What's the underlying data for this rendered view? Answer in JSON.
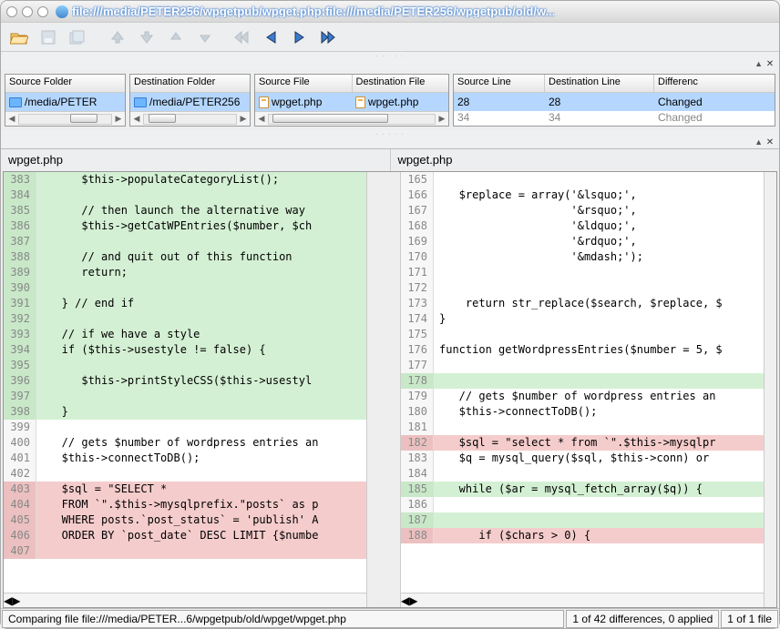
{
  "window": {
    "title": "file:///media/PETER256/wpgetpub/wpget.php:file:///media/PETER256/wpgetpub/old/w..."
  },
  "panels": {
    "source_folder": {
      "header": "Source Folder",
      "value": "/media/PETER"
    },
    "dest_folder": {
      "header": "Destination Folder",
      "value": "/media/PETER256"
    },
    "source_file": {
      "header": "Source File",
      "value": "wpget.php"
    },
    "dest_file": {
      "header": "Destination File",
      "value": "wpget.php"
    },
    "source_line": {
      "header": "Source Line"
    },
    "dest_line": {
      "header": "Destination Line"
    },
    "difference": {
      "header": "Differenc"
    },
    "rows": [
      {
        "src": "28",
        "dst": "28",
        "diff": "Changed"
      },
      {
        "src": "34",
        "dst": "34",
        "diff": "Changed"
      }
    ]
  },
  "diff": {
    "left_title": "wpget.php",
    "right_title": "wpget.php",
    "left": [
      {
        "n": "383",
        "t": "      $this->populateCategoryList();",
        "c": "add"
      },
      {
        "n": "384",
        "t": "",
        "c": "add"
      },
      {
        "n": "385",
        "t": "      // then launch the alternative way",
        "c": "add"
      },
      {
        "n": "386",
        "t": "      $this->getCatWPEntries($number, $ch",
        "c": "add"
      },
      {
        "n": "387",
        "t": "",
        "c": "add"
      },
      {
        "n": "388",
        "t": "      // and quit out of this function",
        "c": "add"
      },
      {
        "n": "389",
        "t": "      return;",
        "c": "add"
      },
      {
        "n": "390",
        "t": "",
        "c": "add"
      },
      {
        "n": "391",
        "t": "   } // end if",
        "c": "add"
      },
      {
        "n": "392",
        "t": "",
        "c": "add"
      },
      {
        "n": "393",
        "t": "   // if we have a style",
        "c": "add"
      },
      {
        "n": "394",
        "t": "   if ($this->usestyle != false) {",
        "c": "add"
      },
      {
        "n": "395",
        "t": "",
        "c": "add"
      },
      {
        "n": "396",
        "t": "      $this->printStyleCSS($this->usestyl",
        "c": "add"
      },
      {
        "n": "397",
        "t": "",
        "c": "add"
      },
      {
        "n": "398",
        "t": "   }",
        "c": "add"
      },
      {
        "n": "399",
        "t": "",
        "c": ""
      },
      {
        "n": "400",
        "t": "   // gets $number of wordpress entries an",
        "c": ""
      },
      {
        "n": "401",
        "t": "   $this->connectToDB();",
        "c": ""
      },
      {
        "n": "402",
        "t": "",
        "c": ""
      },
      {
        "n": "403",
        "t": "   $sql = \"SELECT *",
        "c": "del"
      },
      {
        "n": "404",
        "t": "   FROM `\".$this->mysqlprefix.\"posts` as p",
        "c": "del"
      },
      {
        "n": "405",
        "t": "   WHERE posts.`post_status` = 'publish' A",
        "c": "del"
      },
      {
        "n": "406",
        "t": "   ORDER BY `post_date` DESC LIMIT {$numbe",
        "c": "del"
      },
      {
        "n": "407",
        "t": "",
        "c": "del"
      }
    ],
    "right": [
      {
        "n": "165",
        "t": "",
        "c": ""
      },
      {
        "n": "166",
        "t": "   $replace = array('&lsquo;',",
        "c": ""
      },
      {
        "n": "167",
        "t": "                    '&rsquo;',",
        "c": ""
      },
      {
        "n": "168",
        "t": "                    '&ldquo;',",
        "c": ""
      },
      {
        "n": "169",
        "t": "                    '&rdquo;',",
        "c": ""
      },
      {
        "n": "170",
        "t": "                    '&mdash;');",
        "c": ""
      },
      {
        "n": "171",
        "t": "",
        "c": ""
      },
      {
        "n": "172",
        "t": "",
        "c": ""
      },
      {
        "n": "173",
        "t": "    return str_replace($search, $replace, $",
        "c": ""
      },
      {
        "n": "174",
        "t": "}",
        "c": ""
      },
      {
        "n": "175",
        "t": "",
        "c": ""
      },
      {
        "n": "176",
        "t": "function getWordpressEntries($number = 5, $",
        "c": ""
      },
      {
        "n": "177",
        "t": "",
        "c": ""
      },
      {
        "n": "178",
        "t": "",
        "c": "add"
      },
      {
        "n": "179",
        "t": "   // gets $number of wordpress entries an",
        "c": ""
      },
      {
        "n": "180",
        "t": "   $this->connectToDB();",
        "c": ""
      },
      {
        "n": "181",
        "t": "",
        "c": ""
      },
      {
        "n": "182",
        "t": "   $sql = \"select * from `\".$this->mysqlpr",
        "c": "del"
      },
      {
        "n": "183",
        "t": "   $q = mysql_query($sql, $this->conn) or ",
        "c": ""
      },
      {
        "n": "184",
        "t": "",
        "c": ""
      },
      {
        "n": "185",
        "t": "   while ($ar = mysql_fetch_array($q)) {",
        "c": "add"
      },
      {
        "n": "186",
        "t": "",
        "c": ""
      },
      {
        "n": "187",
        "t": "",
        "c": "add"
      },
      {
        "n": "188",
        "t": "      if ($chars > 0) {",
        "c": "del"
      }
    ]
  },
  "status": {
    "comparing": "Comparing file file:///media/PETER...6/wpgetpub/old/wpget/wpget.php",
    "diffs": "1 of 42 differences, 0 applied",
    "files": "1 of 1 file"
  },
  "close_x": "✕",
  "dots": "· · · · ·"
}
